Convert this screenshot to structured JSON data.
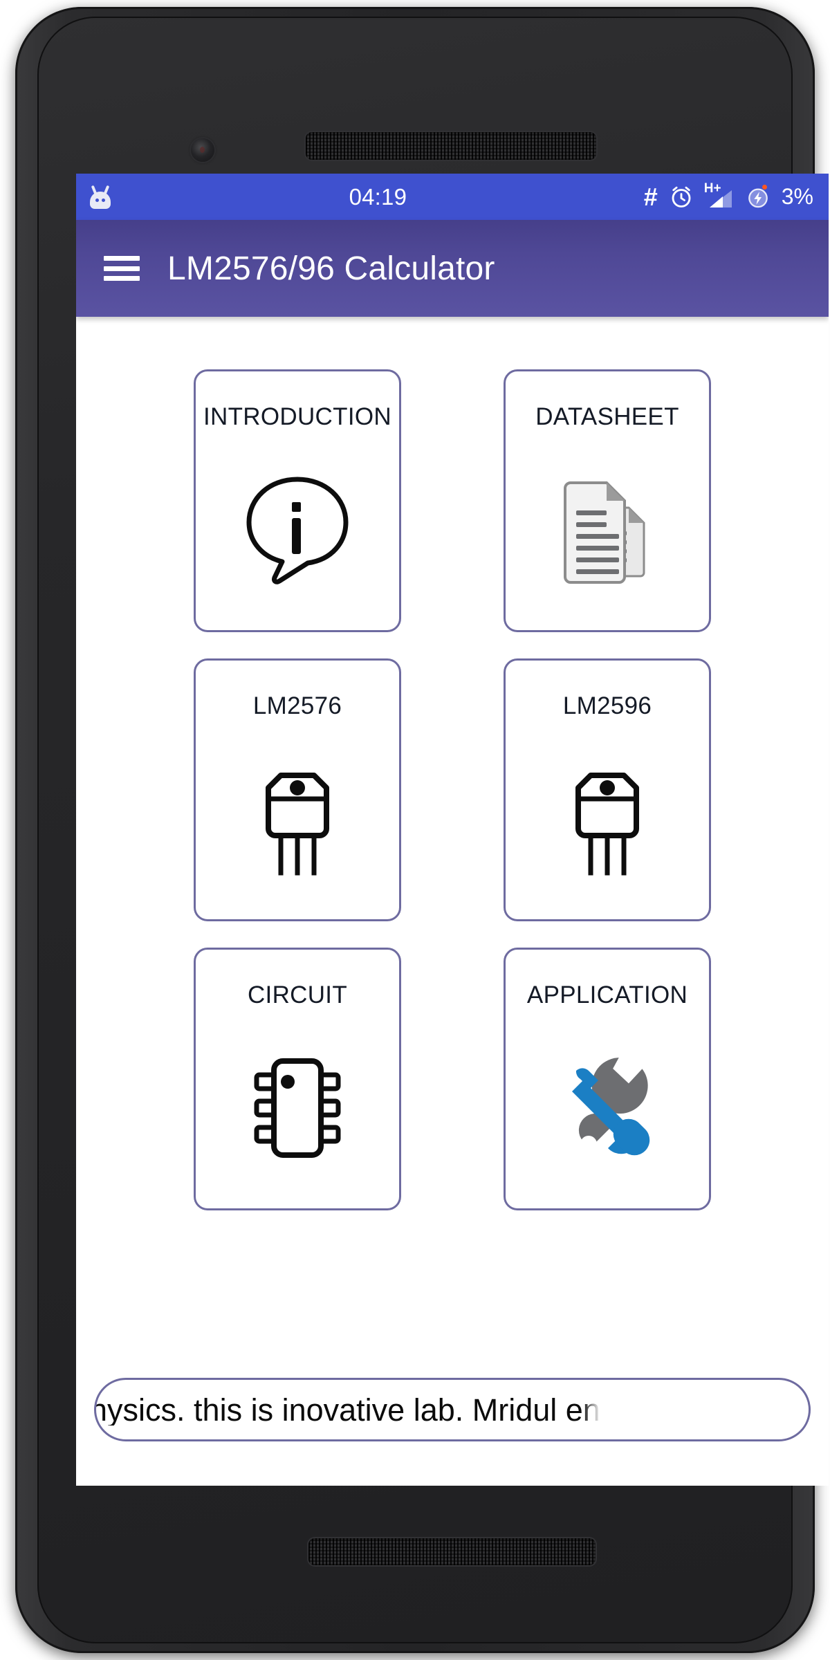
{
  "status_bar": {
    "notification_icon": "android-head-icon",
    "clock": "04:19",
    "icons": [
      "hash-icon",
      "alarm-clock-icon",
      "signal-hplus-icon",
      "charging-battery-icon"
    ],
    "network_type": "H+",
    "battery_percent": "3%",
    "background_color": "#3f51cf"
  },
  "app_bar": {
    "menu_icon": "hamburger-menu-icon",
    "title": "LM2576/96 Calculator",
    "gradient_from": "#463f8a",
    "gradient_to": "#5a53a2"
  },
  "grid": {
    "border_color": "#6e6ba0",
    "cards": [
      {
        "label": "INTRODUCTION",
        "icon": "info-speech-bubble-icon"
      },
      {
        "label": "DATASHEET",
        "icon": "documents-icon"
      },
      {
        "label": "LM2576",
        "icon": "transistor-to220-icon"
      },
      {
        "label": "LM2596",
        "icon": "transistor-to220-icon"
      },
      {
        "label": "CIRCUIT",
        "icon": "ic-chip-icon"
      },
      {
        "label": "APPLICATION",
        "icon": "screwdriver-wrench-icon"
      }
    ]
  },
  "marquee": {
    "text": "physics. this is inovative lab. Mridul en",
    "border_color": "#6e6ba0"
  },
  "colors": {
    "accent_purple": "#6e6ba0",
    "status_blue": "#3f51cf",
    "icon_blue": "#1b7fc4",
    "icon_gray": "#6d6e71",
    "screen_white": "#ffffff"
  }
}
